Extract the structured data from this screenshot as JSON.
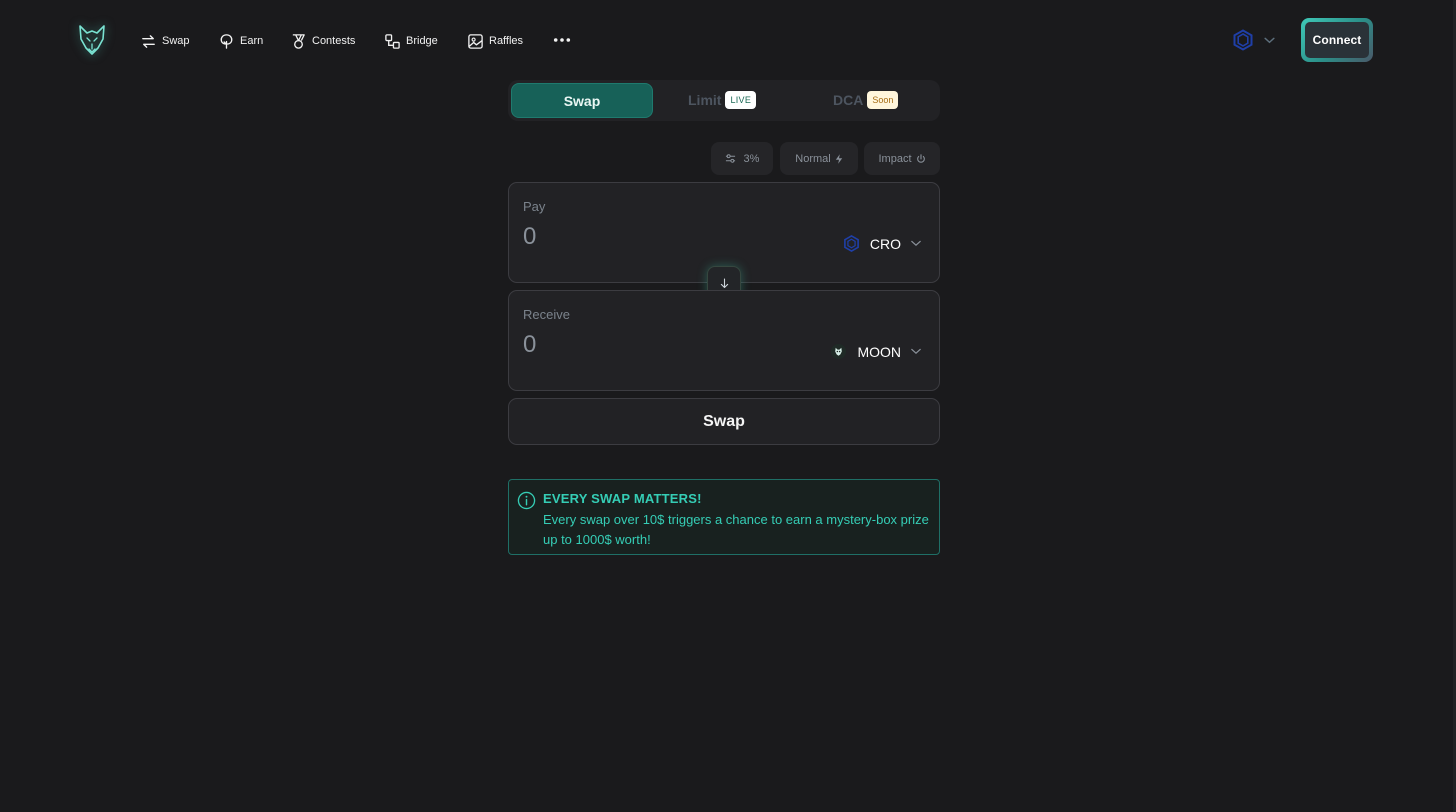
{
  "nav": {
    "logo_icon": "wolf-logo-icon",
    "items": [
      {
        "label": "Swap",
        "icon": "swap-arrows-icon"
      },
      {
        "label": "Earn",
        "icon": "tree-icon"
      },
      {
        "label": "Contests",
        "icon": "medal-icon"
      },
      {
        "label": "Bridge",
        "icon": "bridge-nodes-icon"
      },
      {
        "label": "Raffles",
        "icon": "gallery-icon"
      }
    ],
    "more_icon": "more-dots-icon",
    "network_icon": "cronos-hex-icon",
    "connect_label": "Connect"
  },
  "tabs": {
    "swap": "Swap",
    "limit": "Limit",
    "limit_badge": "LIVE",
    "dca": "DCA",
    "dca_badge": "Soon"
  },
  "settings": {
    "slippage": "3%",
    "speed": "Normal",
    "impact": "Impact"
  },
  "pay": {
    "label": "Pay",
    "amount": "0",
    "token": "CRO",
    "token_icon": "cronos-hex-icon"
  },
  "receive": {
    "label": "Receive",
    "amount": "0",
    "token": "MOON",
    "token_icon": "moon-token-icon"
  },
  "swap_button": "Swap",
  "info": {
    "title": "EVERY SWAP MATTERS!",
    "text": "Every swap over 10$ triggers a chance to earn a mystery-box prize up to 1000$ worth!"
  },
  "colors": {
    "background": "#1a1a1c",
    "panel": "#222225",
    "accent": "#35cdb5",
    "active_tab": "#176158",
    "network_blue": "#1f3fa8"
  }
}
